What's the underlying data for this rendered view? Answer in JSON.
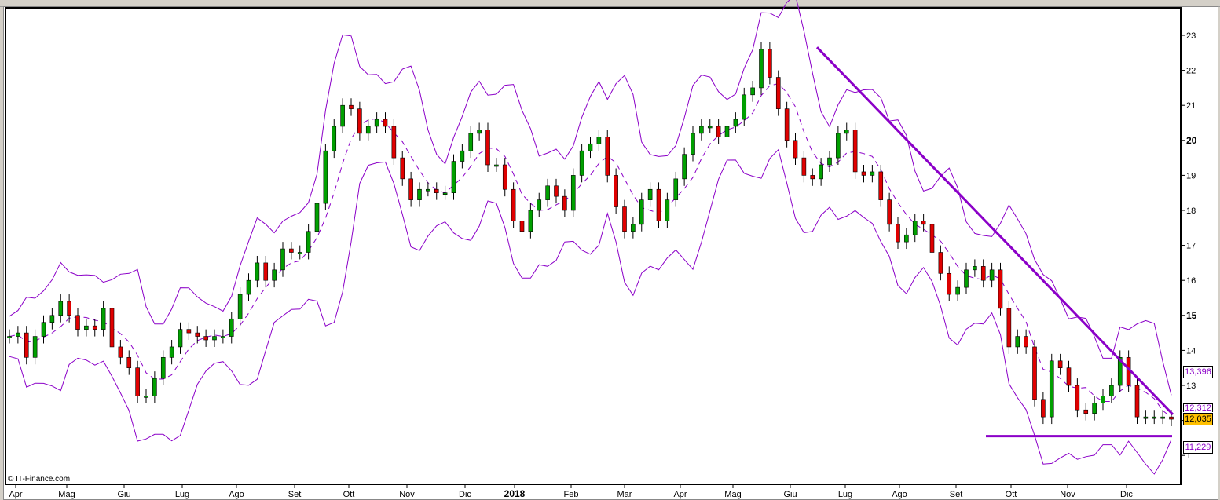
{
  "chart_data": {
    "type": "candlestick",
    "indicator": "Bollinger Bands",
    "watermark": "© IT-Finance.com",
    "y_ticks": [
      11,
      12,
      13,
      14,
      15,
      16,
      17,
      18,
      19,
      20,
      21,
      22,
      23
    ],
    "y_tick_labels": [
      "11",
      "",
      "13",
      "14",
      "15",
      "16",
      "17",
      "18",
      "19",
      "20",
      "21",
      "22",
      "23"
    ],
    "bold_ticks": [
      15,
      20
    ],
    "ylim": [
      10.6,
      23.8
    ],
    "x_labels": [
      "Apr",
      "Mag",
      "Giu",
      "Lug",
      "Ago",
      "Set",
      "Ott",
      "Nov",
      "Dic",
      "2018",
      "Feb",
      "Mar",
      "Apr",
      "Mag",
      "Giu",
      "Lug",
      "Ago",
      "Set",
      "Ott",
      "Nov",
      "Dic"
    ],
    "close": [
      14.4,
      14.5,
      13.8,
      14.4,
      14.8,
      15.0,
      15.4,
      15.0,
      14.6,
      14.7,
      14.6,
      15.2,
      14.1,
      13.8,
      13.5,
      12.7,
      12.7,
      13.2,
      13.8,
      14.1,
      14.6,
      14.5,
      14.4,
      14.3,
      14.4,
      14.4,
      14.9,
      15.6,
      16.0,
      16.5,
      16.0,
      16.3,
      16.9,
      16.8,
      16.8,
      17.4,
      18.2,
      19.7,
      20.4,
      21.0,
      20.9,
      20.2,
      20.4,
      20.6,
      20.4,
      19.5,
      18.9,
      18.3,
      18.6,
      18.6,
      18.5,
      18.5,
      19.4,
      19.7,
      20.2,
      20.3,
      19.3,
      19.3,
      18.6,
      17.7,
      17.4,
      18.0,
      18.3,
      18.7,
      18.4,
      18.0,
      19.0,
      19.7,
      19.9,
      20.1,
      19.0,
      18.1,
      17.4,
      17.6,
      18.3,
      18.6,
      17.7,
      18.3,
      18.9,
      19.6,
      20.2,
      20.4,
      20.4,
      20.1,
      20.4,
      20.6,
      21.3,
      21.5,
      22.6,
      21.8,
      20.9,
      20.0,
      19.5,
      19.0,
      18.9,
      19.3,
      19.5,
      20.2,
      20.3,
      19.1,
      19.0,
      19.1,
      18.3,
      17.6,
      17.1,
      17.3,
      17.7,
      17.6,
      16.8,
      16.2,
      15.6,
      15.8,
      16.3,
      16.4,
      16.0,
      16.3,
      15.2,
      14.1,
      14.4,
      14.1,
      12.6,
      12.1,
      13.7,
      13.5,
      13.0,
      12.3,
      12.2,
      12.5,
      12.7,
      13.0,
      13.8,
      13.0,
      12.1,
      12.1,
      12.1,
      12.1,
      12.035
    ],
    "trendline_resistance": {
      "from": 22.66,
      "to": 12.17
    },
    "support_line": 11.55,
    "colors": {
      "up": "#00a000",
      "down": "#e00000",
      "bands": "#8b00c8",
      "trendline": "#8b00c8",
      "last": "#ffc000"
    },
    "labels": {
      "upper_band": "13,396",
      "middle_band": "12,312",
      "last": "12,035",
      "lower_band": "11,229"
    }
  }
}
